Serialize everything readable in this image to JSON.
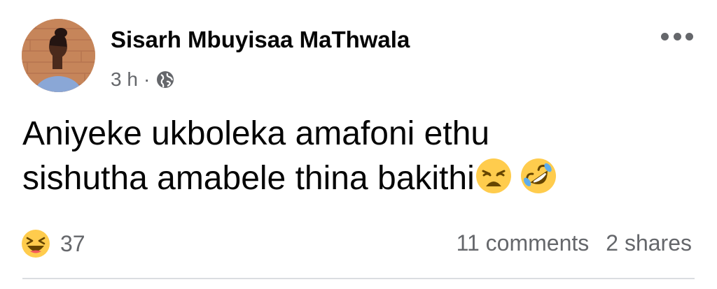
{
  "post": {
    "author": "Sisarh Mbuyisaa MaThwala",
    "time": "3 h",
    "separator": "·",
    "audience_icon": "globe-icon",
    "more_icon": "more-options-icon",
    "text_line1": "Aniyeke ukboleka amafoni ethu",
    "text_line2": "sishutha amabele thina bakithi",
    "text_emojis": [
      "weary-face-emoji",
      "rolling-on-floor-laughing-emoji"
    ],
    "reaction_icon": "haha-reaction-icon",
    "reaction_count": "37",
    "comments": "11 comments",
    "shares": "2 shares"
  },
  "colors": {
    "text": "#050505",
    "secondary": "#65676b",
    "emoji_yellow": "#ffcc4d",
    "divider": "#dadde1"
  }
}
